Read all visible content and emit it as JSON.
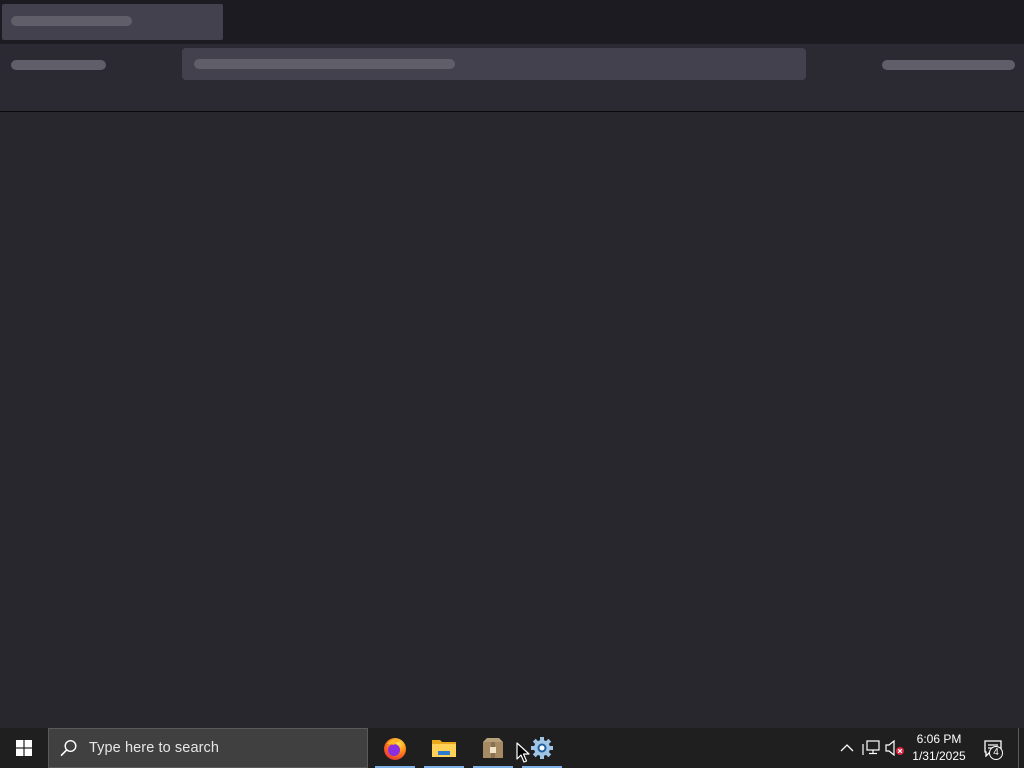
{
  "browser": {
    "state": "loading-skeleton",
    "tab_placeholder": true,
    "url_bar_placeholder": true
  },
  "taskbar": {
    "search": {
      "placeholder": "Type here to search"
    },
    "pinned_apps": [
      {
        "name": "Firefox",
        "icon": "firefox-icon",
        "running": true
      },
      {
        "name": "File Explorer",
        "icon": "folder-icon",
        "running": true
      },
      {
        "name": "Package Manager",
        "icon": "package-icon",
        "running": true
      },
      {
        "name": "Settings",
        "icon": "gear-icon",
        "running": true
      }
    ],
    "tray": {
      "chevron_icon": "chevron-up-icon",
      "network_icon": "network-icon",
      "volume_icon": "volume-muted-icon"
    },
    "clock": {
      "time": "6:06 PM",
      "date": "1/31/2025"
    },
    "notifications": {
      "count": "4",
      "icon": "action-center-icon"
    }
  },
  "colors": {
    "window_bg": "#28272e",
    "tab_strip_bg": "#1c1b22",
    "skeleton": "#5f5e69",
    "taskbar_bg": "#1f1f1f",
    "running_indicator": "#7fb2e8"
  }
}
